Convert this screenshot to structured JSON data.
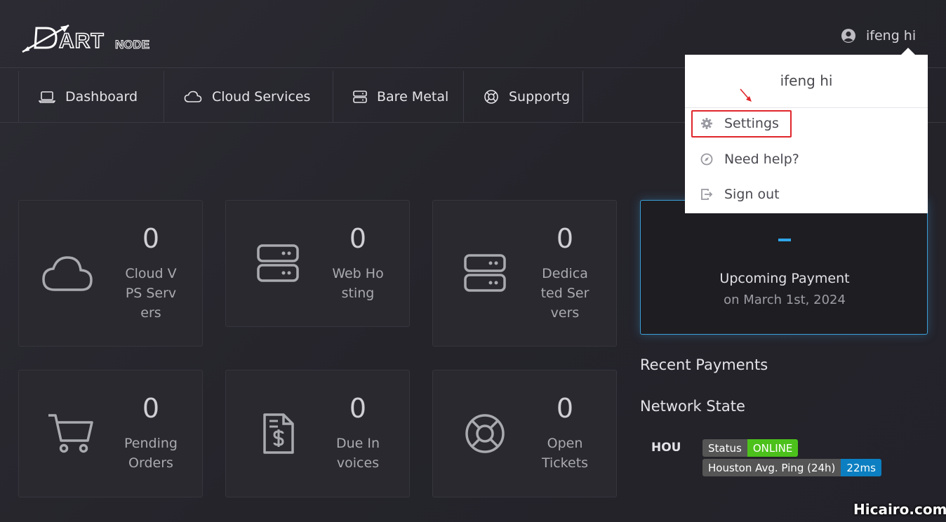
{
  "header": {
    "user_name": "ifeng hi"
  },
  "nav": {
    "items": [
      {
        "label": "Dashboard",
        "icon": "laptop-icon"
      },
      {
        "label": "Cloud Services",
        "icon": "cloud-icon"
      },
      {
        "label": "Bare Metal",
        "icon": "server-icon"
      },
      {
        "label": "Supportg",
        "icon": "lifebuoy-icon"
      }
    ]
  },
  "cards": [
    {
      "count": "0",
      "label": "Cloud VPS Servers",
      "icon": "cloud-icon"
    },
    {
      "count": "0",
      "label": "Web Hosting",
      "icon": "server-icon"
    },
    {
      "count": "0",
      "label": "Dedicated Servers",
      "icon": "server-icon"
    },
    {
      "count": "0",
      "label": "Pending Orders",
      "icon": "cart-icon"
    },
    {
      "count": "0",
      "label": "Due Invoices",
      "icon": "invoice-dollar-icon"
    },
    {
      "count": "0",
      "label": "Open Tickets",
      "icon": "lifebuoy-icon"
    }
  ],
  "payment": {
    "amount": "–",
    "title": "Upcoming Payment",
    "date": "on March 1st, 2024"
  },
  "sections": {
    "recent_payments": "Recent Payments",
    "network_state": "Network State"
  },
  "network": {
    "region": "HOU",
    "status_key": "Status",
    "status_value": "ONLINE",
    "ping_key": "Houston Avg. Ping (24h)",
    "ping_value": "22ms"
  },
  "dropdown": {
    "name": "ifeng hi",
    "items": [
      {
        "label": "Settings",
        "icon": "gear-icon"
      },
      {
        "label": "Need help?",
        "icon": "compass-icon"
      },
      {
        "label": "Sign out",
        "icon": "sign-out-icon"
      }
    ]
  },
  "watermark": "Hicairo.com",
  "colors": {
    "accent": "#3b9fd8",
    "online": "#4cc11c",
    "ping": "#0b7fc1",
    "highlight": "#e0262b"
  }
}
